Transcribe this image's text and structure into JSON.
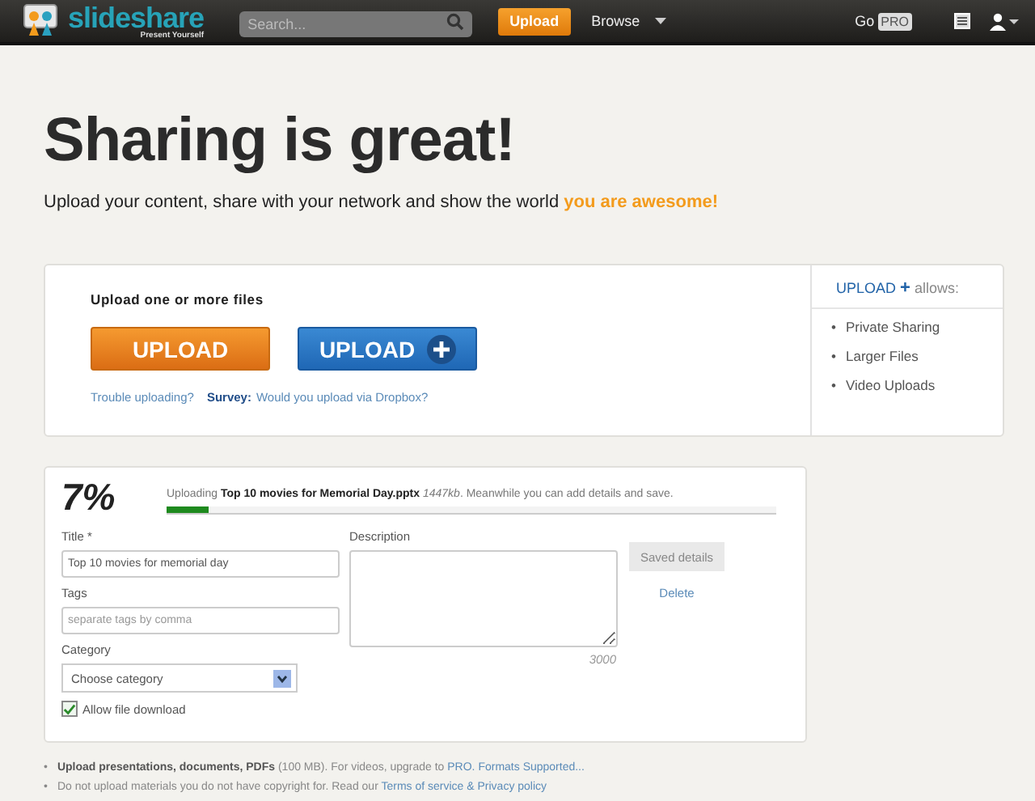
{
  "header": {
    "logo": "slideshare",
    "tagline": "Present Yourself",
    "search": {
      "placeholder": "Search..."
    },
    "upload_button": "Upload",
    "browse": "Browse",
    "go": "Go",
    "pro": "PRO"
  },
  "hero": {
    "title": "Sharing is great!",
    "subtitle": "Upload your content, share with your network and show the world ",
    "highlight": "you are awesome!"
  },
  "upload": {
    "heading": "Upload one or more files",
    "upload_button": "UPLOAD",
    "upload_plus_button": "UPLOAD",
    "trouble_link": "Trouble uploading?",
    "survey_label": "Survey:",
    "survey_link": "Would you upload via Dropbox?"
  },
  "plus_panel": {
    "title": "UPLOAD",
    "plus": "+",
    "suffix": "allows:",
    "items": [
      {
        "bullet": "•",
        "text": "Private Sharing"
      },
      {
        "bullet": "•",
        "text": "Larger Files"
      },
      {
        "bullet": "•",
        "text": "Video Uploads"
      }
    ]
  },
  "progress": {
    "percent": "7%",
    "message": "Uploading **Top 10 movies for Memorial Day.pptx** *1447kb*. Meanwhile you can add details and save.",
    "level": 0.07
  },
  "form": {
    "title_label": "Title *",
    "title_value": "Top 10 movies for memorial day",
    "tags_label": "Tags",
    "tags_placeholder": "separate tags by comma",
    "category_label": "Category",
    "category_value": "Choose category",
    "allow_download": {
      "label": "Allow file download",
      "checked": true
    },
    "description_label": "Description",
    "char_count": "3000",
    "save_button": "Saved details",
    "delete_link": "Delete"
  },
  "notes": [
    {
      "bullet": "•",
      "bold": "Upload presentations, documents, PDFs",
      "text": " (100 MB). For videos, upgrade to ",
      "link": "PRO. Formats Supported..."
    },
    {
      "bullet": "•",
      "text": "Do not upload materials you do not have copyright for. Read our ",
      "link": "Terms of service & Privacy policy"
    }
  ]
}
